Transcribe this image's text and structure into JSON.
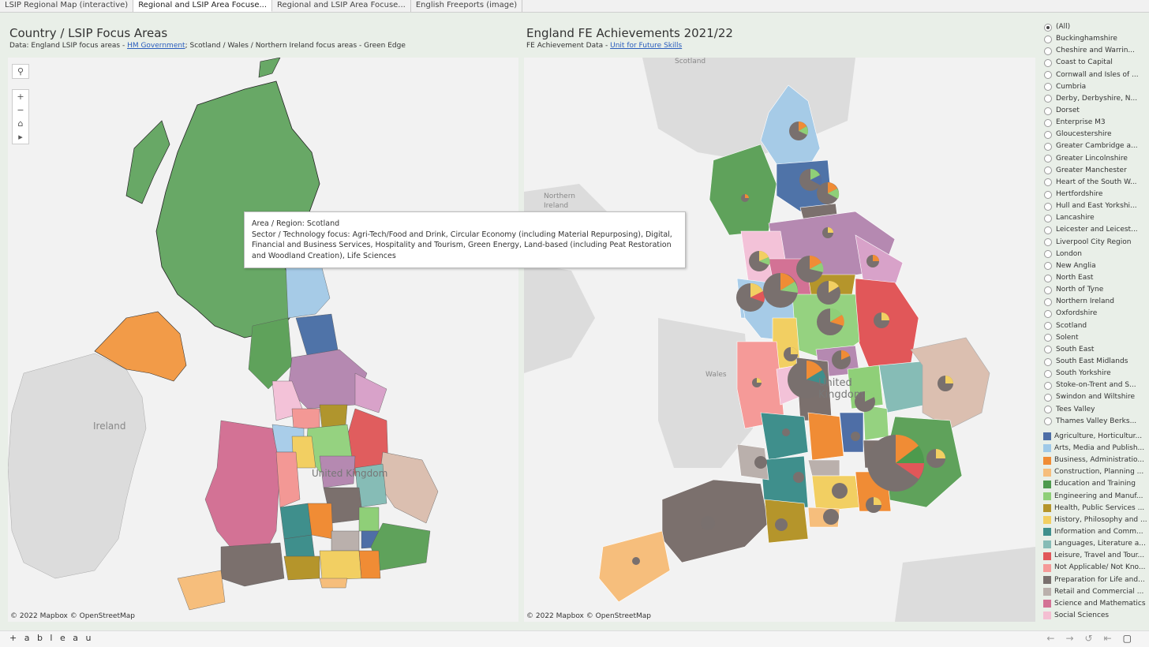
{
  "tabs": [
    "LSIP Regional Map (interactive)",
    "Regional and LSIP Area Focuse...",
    "Regional and LSIP Area Focuse...",
    "English Freeports (image)"
  ],
  "left": {
    "title": "Country / LSIP Focus Areas",
    "sub_prefix": "Data: England LSIP focus areas - ",
    "sub_link": "HM Government",
    "sub_suffix": "; Scotland / Wales / Northern Ireland focus areas - Green Edge",
    "credit": "© 2022 Mapbox  © OpenStreetMap",
    "labels": {
      "ireland": "Ireland",
      "uk": "United Kingdom"
    }
  },
  "right": {
    "title": "England FE Achievements 2021/22",
    "sub_prefix": "FE Achievement Data - ",
    "sub_link": "Unit for Future Skills",
    "credit": "© 2022 Mapbox  © OpenStreetMap",
    "labels": {
      "scotland": "Scotland",
      "ni": "Northern Ireland",
      "wales": "Wales",
      "uk": "United Kingdom"
    }
  },
  "tooltip": {
    "area_line": "Area / Region:  Scotland",
    "focus_line": "Sector / Technology focus: Agri-Tech/Food and Drink, Circular Economy (including Material Repurposing), Digital, Financial and Business Services, Hospitality and Tourism, Green Energy, Land-based (including Peat Restoration and Woodland Creation), Life Sciences"
  },
  "area_filter": [
    "(All)",
    "Buckinghamshire",
    "Cheshire and Warrin...",
    "Coast to Capital",
    "Cornwall and Isles of ...",
    "Cumbria",
    "Derby, Derbyshire, N...",
    "Dorset",
    "Enterprise M3",
    "Gloucestershire",
    "Greater Cambridge a...",
    "Greater Lincolnshire",
    "Greater Manchester",
    "Heart of the South W...",
    "Hertfordshire",
    "Hull and East Yorkshi...",
    "Lancashire",
    "Leicester and Leicest...",
    "Liverpool City Region",
    "London",
    "New Anglia",
    "North East",
    "North of Tyne",
    "Northern Ireland",
    "Oxfordshire",
    "Scotland",
    "Solent",
    "South East",
    "South East Midlands",
    "South Yorkshire",
    "Stoke-on-Trent and S...",
    "Swindon and Wiltshire",
    "Tees Valley",
    "Thames Valley Berks..."
  ],
  "sector_legend": [
    {
      "label": "Agriculture, Horticultur...",
      "color": "#4e6ea6"
    },
    {
      "label": "Arts, Media and Publish...",
      "color": "#9fc9e8"
    },
    {
      "label": "Business, Administratio...",
      "color": "#f08c35"
    },
    {
      "label": "Construction, Planning ...",
      "color": "#f6be7c"
    },
    {
      "label": "Education and Training",
      "color": "#4d9a4d"
    },
    {
      "label": "Engineering and Manuf...",
      "color": "#8fcf78"
    },
    {
      "label": "Health, Public Services ...",
      "color": "#b5952b"
    },
    {
      "label": "History, Philosophy and ...",
      "color": "#f2cf62"
    },
    {
      "label": "Information and Comm...",
      "color": "#3f8f8c"
    },
    {
      "label": "Languages, Literature a...",
      "color": "#86bcb6"
    },
    {
      "label": "Leisure, Travel and Tour...",
      "color": "#e15759"
    },
    {
      "label": "Not Applicable/ Not Kno...",
      "color": "#f59a98"
    },
    {
      "label": "Preparation for Life and...",
      "color": "#79706e"
    },
    {
      "label": "Retail and Commercial ...",
      "color": "#bab0ac"
    },
    {
      "label": "Science and Mathematics",
      "color": "#d37295"
    },
    {
      "label": "Social Sciences",
      "color": "#f4bfd2"
    }
  ],
  "footer": {
    "brand": "+ a b l e a u"
  }
}
